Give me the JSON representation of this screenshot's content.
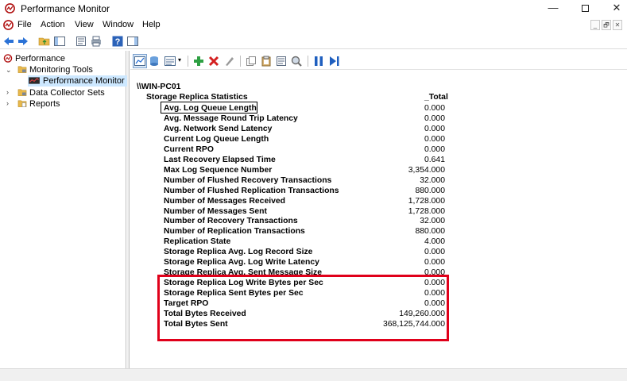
{
  "window": {
    "title": "Performance Monitor",
    "controls": {
      "minimize": "—",
      "maximize": "",
      "close": "✕"
    }
  },
  "menu": {
    "items": [
      "File",
      "Action",
      "View",
      "Window",
      "Help"
    ],
    "mdi": [
      "_",
      "🗗",
      "✕"
    ]
  },
  "tree": {
    "root": "Performance",
    "monitoring_tools": "Monitoring Tools",
    "performance_monitor": "Performance Monitor",
    "data_collector_sets": "Data Collector Sets",
    "reports": "Reports"
  },
  "report": {
    "machine": "\\\\WIN-PC01",
    "object": "Storage Replica Statistics",
    "instance": "_Total",
    "counters": [
      {
        "name": "Avg. Log Queue Length",
        "value": "0.000"
      },
      {
        "name": "Avg. Message Round Trip Latency",
        "value": "0.000"
      },
      {
        "name": "Avg. Network Send Latency",
        "value": "0.000"
      },
      {
        "name": "Current Log Queue Length",
        "value": "0.000"
      },
      {
        "name": "Current RPO",
        "value": "0.000"
      },
      {
        "name": "Last Recovery Elapsed Time",
        "value": "0.641"
      },
      {
        "name": "Max Log Sequence Number",
        "value": "3,354.000"
      },
      {
        "name": "Number of Flushed Recovery Transactions",
        "value": "32.000"
      },
      {
        "name": "Number of Flushed Replication Transactions",
        "value": "880.000"
      },
      {
        "name": "Number of Messages Received",
        "value": "1,728.000"
      },
      {
        "name": "Number of Messages Sent",
        "value": "1,728.000"
      },
      {
        "name": "Number of Recovery Transactions",
        "value": "32.000"
      },
      {
        "name": "Number of Replication Transactions",
        "value": "880.000"
      },
      {
        "name": "Replication State",
        "value": "4.000"
      },
      {
        "name": "Storage Replica Avg. Log Record Size",
        "value": "0.000"
      },
      {
        "name": "Storage Replica Avg. Log Write Latency",
        "value": "0.000"
      },
      {
        "name": "Storage Replica Avg. Sent Message Size",
        "value": "0.000"
      },
      {
        "name": "Storage Replica Log Write Bytes per Sec",
        "value": "0.000"
      },
      {
        "name": "Storage Replica Sent Bytes per Sec",
        "value": "0.000"
      },
      {
        "name": "Target RPO",
        "value": "0.000"
      },
      {
        "name": "Total Bytes Received",
        "value": "149,260.000"
      },
      {
        "name": "Total Bytes Sent",
        "value": "368,125,744.000"
      }
    ]
  },
  "colors": {
    "highlight_box": "#e0001a",
    "selection": "#cde8ff",
    "play_icon": "#1f5fbf",
    "add_icon": "#2ea043",
    "delete_icon": "#d42020"
  }
}
